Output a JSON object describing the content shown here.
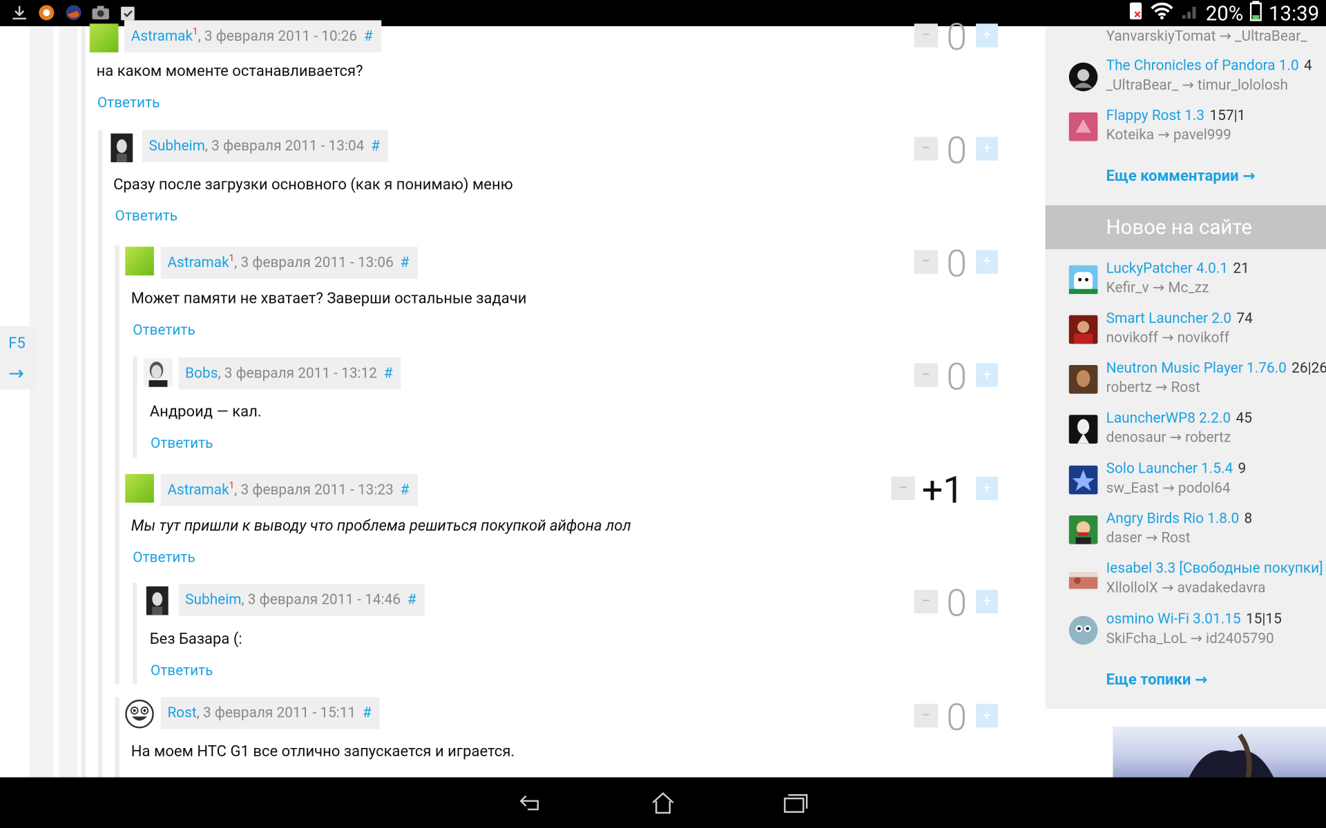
{
  "status_bar": {
    "battery": "20%",
    "time": "13:39",
    "icons": [
      "download-icon",
      "orange-app-icon",
      "firefox-icon",
      "camera-icon",
      "clipboard-check-icon"
    ]
  },
  "side_panel": {
    "refresh": "F5",
    "arrow": "→"
  },
  "comments": [
    {
      "author": "Astramak",
      "badge": "1",
      "date": ", 3 февраля 2011 - 10:26",
      "hash": "#",
      "text": "на каком моменте останавливается?",
      "reply": "Ответить",
      "score": "0",
      "minus": "−",
      "plus": "+"
    },
    {
      "author": "Subheim",
      "badge": "",
      "date": ", 3 февраля 2011 - 13:04",
      "hash": "#",
      "text": "Сразу после загрузки основного (как я понимаю) меню",
      "reply": "Ответить",
      "score": "0",
      "minus": "−",
      "plus": "+"
    },
    {
      "author": "Astramak",
      "badge": "1",
      "date": ", 3 февраля 2011 - 13:06",
      "hash": "#",
      "text": "Может памяти не хватает? Заверши остальные задачи",
      "reply": "Ответить",
      "score": "0",
      "minus": "−",
      "plus": "+"
    },
    {
      "author": "Bobs",
      "badge": "",
      "date": ", 3 февраля 2011 - 13:12",
      "hash": "#",
      "text": "Андроид — кал.",
      "reply": "Ответить",
      "score": "0",
      "minus": "−",
      "plus": "+"
    },
    {
      "author": "Astramak",
      "badge": "1",
      "date": ", 3 февраля 2011 - 13:23",
      "hash": "#",
      "text": "Мы тут пришли к выводу что проблема решиться покупкой айфона лол",
      "reply": "Ответить",
      "score": "+1",
      "minus": "−",
      "plus": "+"
    },
    {
      "author": "Subheim",
      "badge": "",
      "date": ", 3 февраля 2011 - 14:46",
      "hash": "#",
      "text": "Без Базара (:",
      "reply": "Ответить",
      "score": "0",
      "minus": "−",
      "plus": "+"
    },
    {
      "author": "Rost",
      "badge": "",
      "date": ", 3 февраля 2011 - 15:11",
      "hash": "#",
      "text": "На моем HTC G1 все отлично запускается и играется.",
      "reply": "",
      "score": "0",
      "minus": "−",
      "plus": "+"
    }
  ],
  "sidebar": {
    "top_partial_users": "YanvarskiyTomat → _UltraBear_",
    "comment_items": [
      {
        "title": "The Chronicles of Pandora 1.0",
        "count": "4",
        "users": "_UltraBear_ → timur_lololosh"
      },
      {
        "title": "Flappy Rost 1.3",
        "count": "157|1",
        "users": "Koteika → pavel999"
      }
    ],
    "more_comments": "Еще комментарии →",
    "new_header": "Новое на сайте",
    "new_items": [
      {
        "title": "LuckyPatcher 4.0.1",
        "count": "21",
        "users": "Kefir_v → Mc_zz"
      },
      {
        "title": "Smart Launcher 2.0",
        "count": "74",
        "users": "novikoff → novikoff"
      },
      {
        "title": "Neutron Music Player 1.76.0",
        "count": "26|26",
        "users": "robertz → Rost"
      },
      {
        "title": "LauncherWP8 2.2.0",
        "count": "45",
        "users": "denosaur → robertz"
      },
      {
        "title": "Solo Launcher 1.5.4",
        "count": "9",
        "users": "sw_East → podol64"
      },
      {
        "title": "Angry Birds Rio 1.8.0",
        "count": "8",
        "users": "daser → Rost"
      },
      {
        "title": "Iesabel 3.3 [Свободные покупки]",
        "count": "",
        "users": "XllollolX → avadakedavra"
      },
      {
        "title": "osmino Wi-Fi 3.01.15",
        "count": "15|15",
        "users": "SkiFcha_LoL → id2405790"
      }
    ],
    "more_topics": "Еще топики →"
  }
}
